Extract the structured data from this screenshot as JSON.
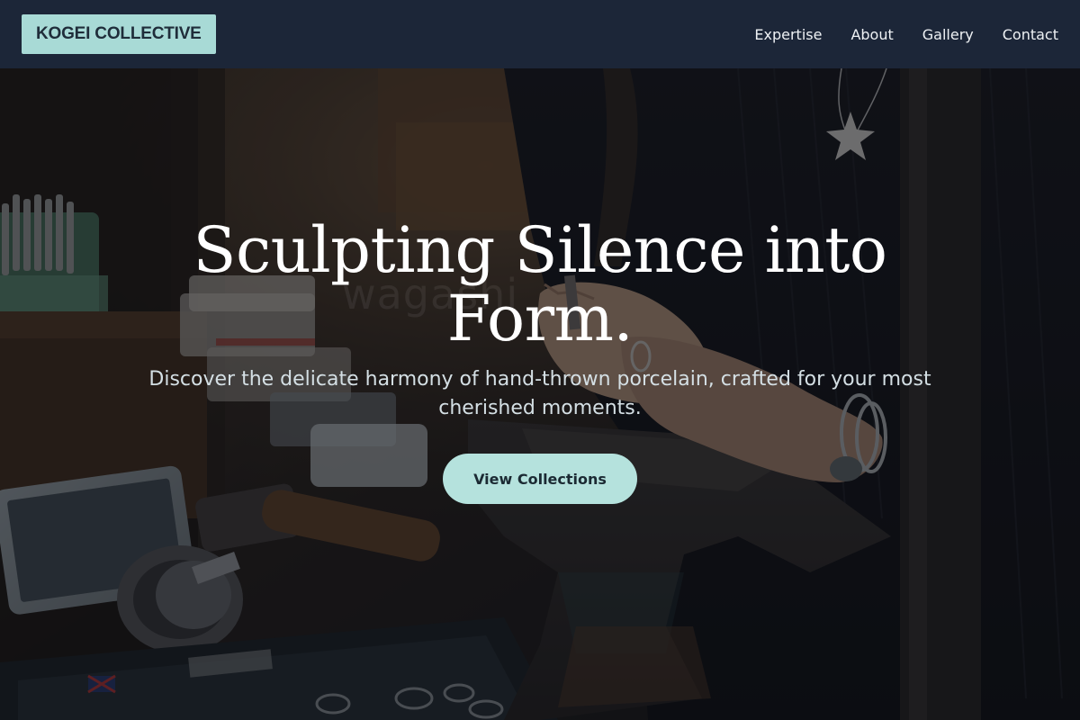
{
  "header": {
    "logo": "KOGEI COLLECTIVE",
    "nav": [
      {
        "label": "Expertise"
      },
      {
        "label": "About"
      },
      {
        "label": "Gallery"
      },
      {
        "label": "Contact"
      }
    ]
  },
  "hero": {
    "title": "Sculpting Silence into Form.",
    "subtitle": "Discover the delicate harmony of hand-thrown porcelain, crafted for your most cherished moments.",
    "cta_label": "View Collections",
    "watermark": "wagashi"
  },
  "colors": {
    "header_bg": "#1c2638",
    "logo_bg": "#a8dad6",
    "cta_bg": "#b5e2dd"
  }
}
